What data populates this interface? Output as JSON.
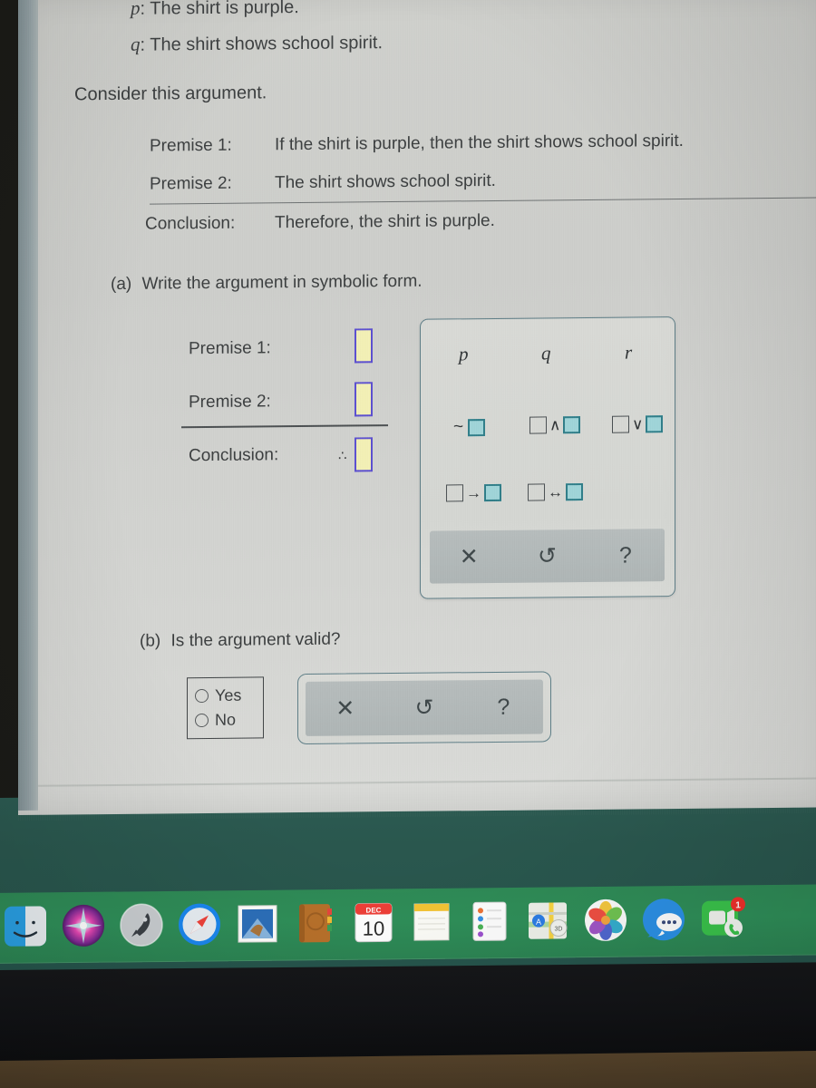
{
  "problem": {
    "definitions": [
      {
        "var": "p",
        "text": ": The shirt is purple."
      },
      {
        "var": "q",
        "text": ": The shirt shows school spirit."
      }
    ],
    "consider": "Consider this argument.",
    "argument": {
      "premise1_label": "Premise 1:",
      "premise1_text": "If the shirt is purple, then the shirt shows school spirit.",
      "premise2_label": "Premise 2:",
      "premise2_text": "The shirt shows school spirit.",
      "conclusion_label": "Conclusion:",
      "conclusion_text": "Therefore, the shirt is purple."
    },
    "part_a": {
      "label": "(a)",
      "prompt": "Write the argument in symbolic form.",
      "rows": [
        {
          "label": "Premise 1:",
          "value": ""
        },
        {
          "label": "Premise 2:",
          "value": ""
        },
        {
          "label": "Conclusion:",
          "prefix": "∴",
          "value": ""
        }
      ]
    },
    "part_b": {
      "label": "(b)",
      "prompt": "Is the argument valid?",
      "options": [
        "Yes",
        "No"
      ],
      "selected": ""
    }
  },
  "palette": {
    "variables": [
      "p",
      "q",
      "r"
    ],
    "operators": [
      {
        "name": "negation",
        "display": "~□"
      },
      {
        "name": "conjunction",
        "display": "□∧□"
      },
      {
        "name": "disjunction",
        "display": "□∨□"
      },
      {
        "name": "conditional",
        "display": "□→□"
      },
      {
        "name": "biconditional",
        "display": "□↔□"
      }
    ],
    "op_symbols": {
      "tilde": "~",
      "and": "∧",
      "or": "∨",
      "arrow": "→",
      "dblarrow": "↔"
    },
    "tools": [
      {
        "name": "clear",
        "glyph": "✕"
      },
      {
        "name": "undo",
        "glyph": "↺"
      },
      {
        "name": "help",
        "glyph": "?"
      }
    ],
    "colors": {
      "box_fill": "#9fd4d8",
      "box_stroke": "#2f7d88",
      "panel_border": "#5d7d86",
      "answer_fill": "#f3f0b5",
      "answer_stroke": "#5b4fd0"
    }
  },
  "part_b_tools": [
    {
      "name": "clear",
      "glyph": "✕"
    },
    {
      "name": "undo",
      "glyph": "↺"
    },
    {
      "name": "help",
      "glyph": "?"
    }
  ],
  "dock": {
    "items": [
      {
        "name": "finder",
        "label": "Finder"
      },
      {
        "name": "siri",
        "label": "Siri"
      },
      {
        "name": "launchpad",
        "label": "Launchpad"
      },
      {
        "name": "safari",
        "label": "Safari"
      },
      {
        "name": "mail",
        "label": "Mail"
      },
      {
        "name": "contacts",
        "label": "Contacts"
      },
      {
        "name": "calendar",
        "label": "Calendar"
      },
      {
        "name": "notes",
        "label": "Notes"
      },
      {
        "name": "reminders",
        "label": "Reminders"
      },
      {
        "name": "maps",
        "label": "Maps"
      },
      {
        "name": "photos",
        "label": "Photos"
      },
      {
        "name": "messages",
        "label": "Messages"
      },
      {
        "name": "facetime",
        "label": "FaceTime"
      }
    ],
    "calendar": {
      "month": "DEC",
      "day": "10"
    },
    "facetime_badge": "1",
    "background": "#2f8a56"
  }
}
